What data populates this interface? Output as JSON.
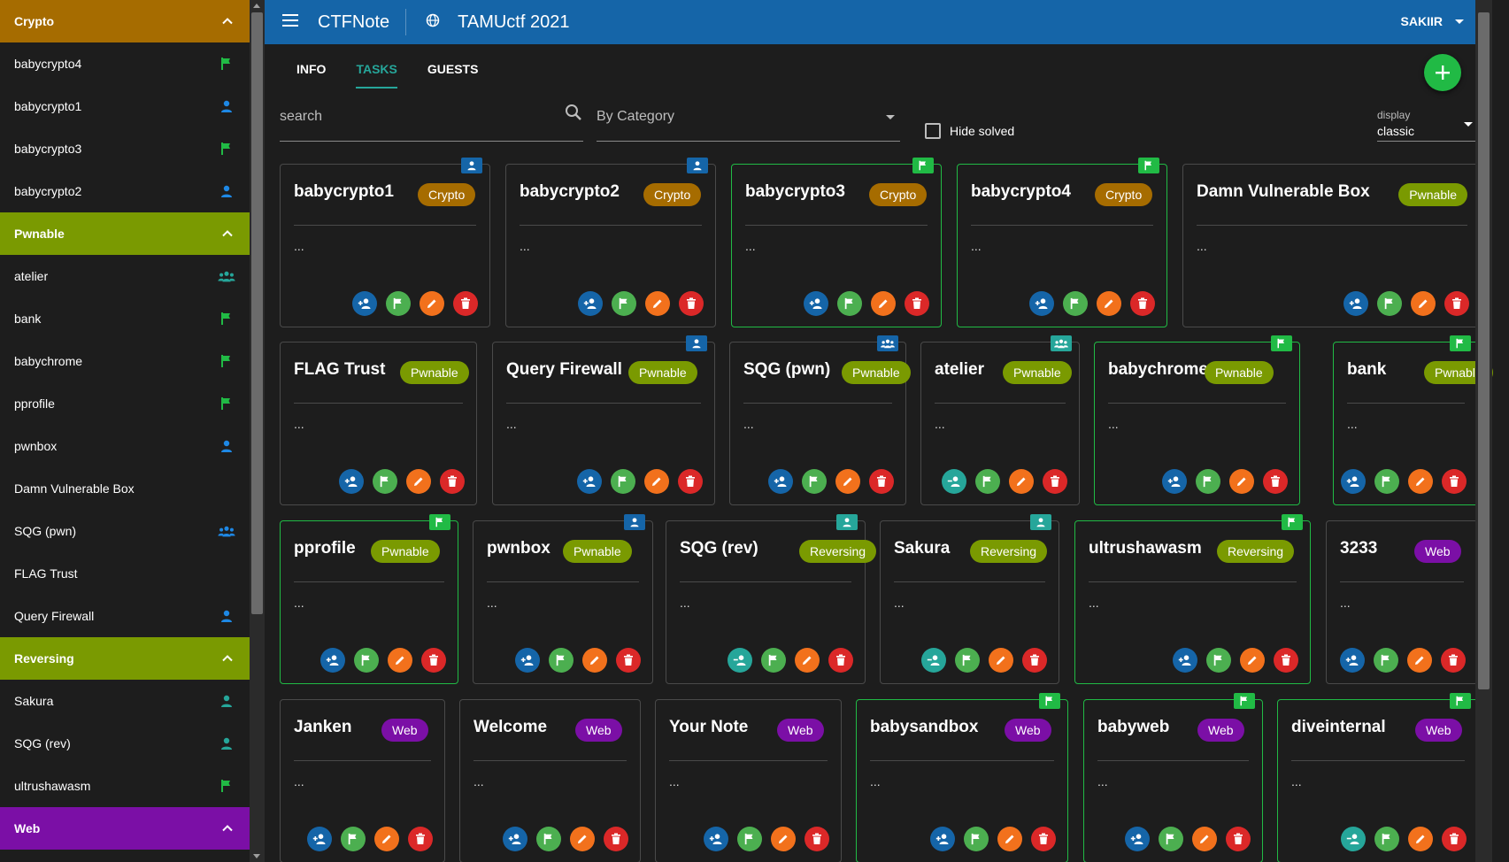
{
  "colors": {
    "crypto": "#a66c00",
    "pwnable": "#7a9a01",
    "reversing": "#7a9a01",
    "web": "#7b0fa6",
    "topbar": "#1565a8",
    "accent": "#26a69a",
    "solved": "#21ba45"
  },
  "topbar": {
    "menu_icon": "menu-icon",
    "app_name": "CTFNote",
    "globe_icon": "globe-icon",
    "ctf_name": "TAMUctf 2021",
    "user": "SAKIIR"
  },
  "tabs": [
    "INFO",
    "TASKS",
    "GUESTS"
  ],
  "filters": {
    "search_placeholder": "search",
    "category": "By Category",
    "hide_solved": "Hide solved",
    "display_label": "display",
    "display_value": "classic"
  },
  "sidebar": {
    "sections": [
      {
        "name": "Crypto",
        "color": "#a66c00",
        "items": [
          {
            "label": "babycrypto4",
            "status": "flag"
          },
          {
            "label": "babycrypto1",
            "status": "person"
          },
          {
            "label": "babycrypto3",
            "status": "flag"
          },
          {
            "label": "babycrypto2",
            "status": "person"
          }
        ]
      },
      {
        "name": "Pwnable",
        "color": "#7a9a01",
        "items": [
          {
            "label": "atelier",
            "status": "group-teal"
          },
          {
            "label": "bank",
            "status": "flag"
          },
          {
            "label": "babychrome",
            "status": "flag"
          },
          {
            "label": "pprofile",
            "status": "flag"
          },
          {
            "label": "pwnbox",
            "status": "person"
          },
          {
            "label": "Damn Vulnerable Box",
            "status": "none"
          },
          {
            "label": "SQG (pwn)",
            "status": "group"
          },
          {
            "label": "FLAG Trust",
            "status": "none"
          },
          {
            "label": "Query Firewall",
            "status": "person"
          }
        ]
      },
      {
        "name": "Reversing",
        "color": "#7a9a01",
        "items": [
          {
            "label": "Sakura",
            "status": "person-teal"
          },
          {
            "label": "SQG (rev)",
            "status": "person-teal"
          },
          {
            "label": "ultrushawasm",
            "status": "flag"
          }
        ]
      },
      {
        "name": "Web",
        "color": "#7b0fa6",
        "items": []
      }
    ]
  },
  "tasks": [
    {
      "title": "babycrypto1",
      "category": "Crypto",
      "desc": "...",
      "badge": "person",
      "solved": false,
      "assign": "blue"
    },
    {
      "title": "babycrypto2",
      "category": "Crypto",
      "desc": "...",
      "badge": "person",
      "solved": false,
      "assign": "blue"
    },
    {
      "title": "babycrypto3",
      "category": "Crypto",
      "desc": "...",
      "badge": "flag",
      "solved": true,
      "assign": "blue"
    },
    {
      "title": "babycrypto4",
      "category": "Crypto",
      "desc": "...",
      "badge": "flag",
      "solved": true,
      "assign": "blue"
    },
    {
      "title": "Damn Vulnerable Box",
      "category": "Pwnable",
      "desc": "...",
      "badge": "none",
      "solved": false,
      "assign": "blue"
    },
    {
      "title": "FLAG Trust",
      "category": "Pwnable",
      "desc": "...",
      "badge": "none",
      "solved": false,
      "assign": "blue"
    },
    {
      "title": "Query Firewall",
      "category": "Pwnable",
      "desc": "...",
      "badge": "person",
      "solved": false,
      "assign": "blue"
    },
    {
      "title": "SQG (pwn)",
      "category": "Pwnable",
      "desc": "...",
      "badge": "group",
      "solved": false,
      "assign": "blue"
    },
    {
      "title": "atelier",
      "category": "Pwnable",
      "desc": "...",
      "badge": "group-teal",
      "solved": false,
      "assign": "teal"
    },
    {
      "title": "babychrome",
      "category": "Pwnable",
      "desc": "...",
      "badge": "flag",
      "solved": true,
      "assign": "blue"
    },
    {
      "title": "bank",
      "category": "Pwnable",
      "desc": "...",
      "badge": "flag",
      "solved": true,
      "assign": "blue"
    },
    {
      "title": "pprofile",
      "category": "Pwnable",
      "desc": "...",
      "badge": "flag",
      "solved": true,
      "assign": "blue"
    },
    {
      "title": "pwnbox",
      "category": "Pwnable",
      "desc": "...",
      "badge": "person",
      "solved": false,
      "assign": "blue"
    },
    {
      "title": "SQG (rev)",
      "category": "Reversing",
      "desc": "...",
      "badge": "person-teal",
      "solved": false,
      "assign": "teal"
    },
    {
      "title": "Sakura",
      "category": "Reversing",
      "desc": "...",
      "badge": "person-teal",
      "solved": false,
      "assign": "teal"
    },
    {
      "title": "ultrushawasm",
      "category": "Reversing",
      "desc": "...",
      "badge": "flag",
      "solved": true,
      "assign": "blue"
    },
    {
      "title": "3233",
      "category": "Web",
      "desc": "...",
      "badge": "none",
      "solved": false,
      "assign": "blue"
    },
    {
      "title": "Janken",
      "category": "Web",
      "desc": "...",
      "badge": "none",
      "solved": false,
      "assign": "blue"
    },
    {
      "title": "Welcome",
      "category": "Web",
      "desc": "...",
      "badge": "none",
      "solved": false,
      "assign": "blue"
    },
    {
      "title": "Your Note",
      "category": "Web",
      "desc": "...",
      "badge": "none",
      "solved": false,
      "assign": "blue"
    },
    {
      "title": "babysandbox",
      "category": "Web",
      "desc": "...",
      "badge": "flag",
      "solved": true,
      "assign": "blue"
    },
    {
      "title": "babyweb",
      "category": "Web",
      "desc": "...",
      "badge": "flag",
      "solved": true,
      "assign": "blue"
    },
    {
      "title": "diveinternal",
      "category": "Web",
      "desc": "...",
      "badge": "flag",
      "solved": true,
      "assign": "teal"
    }
  ]
}
